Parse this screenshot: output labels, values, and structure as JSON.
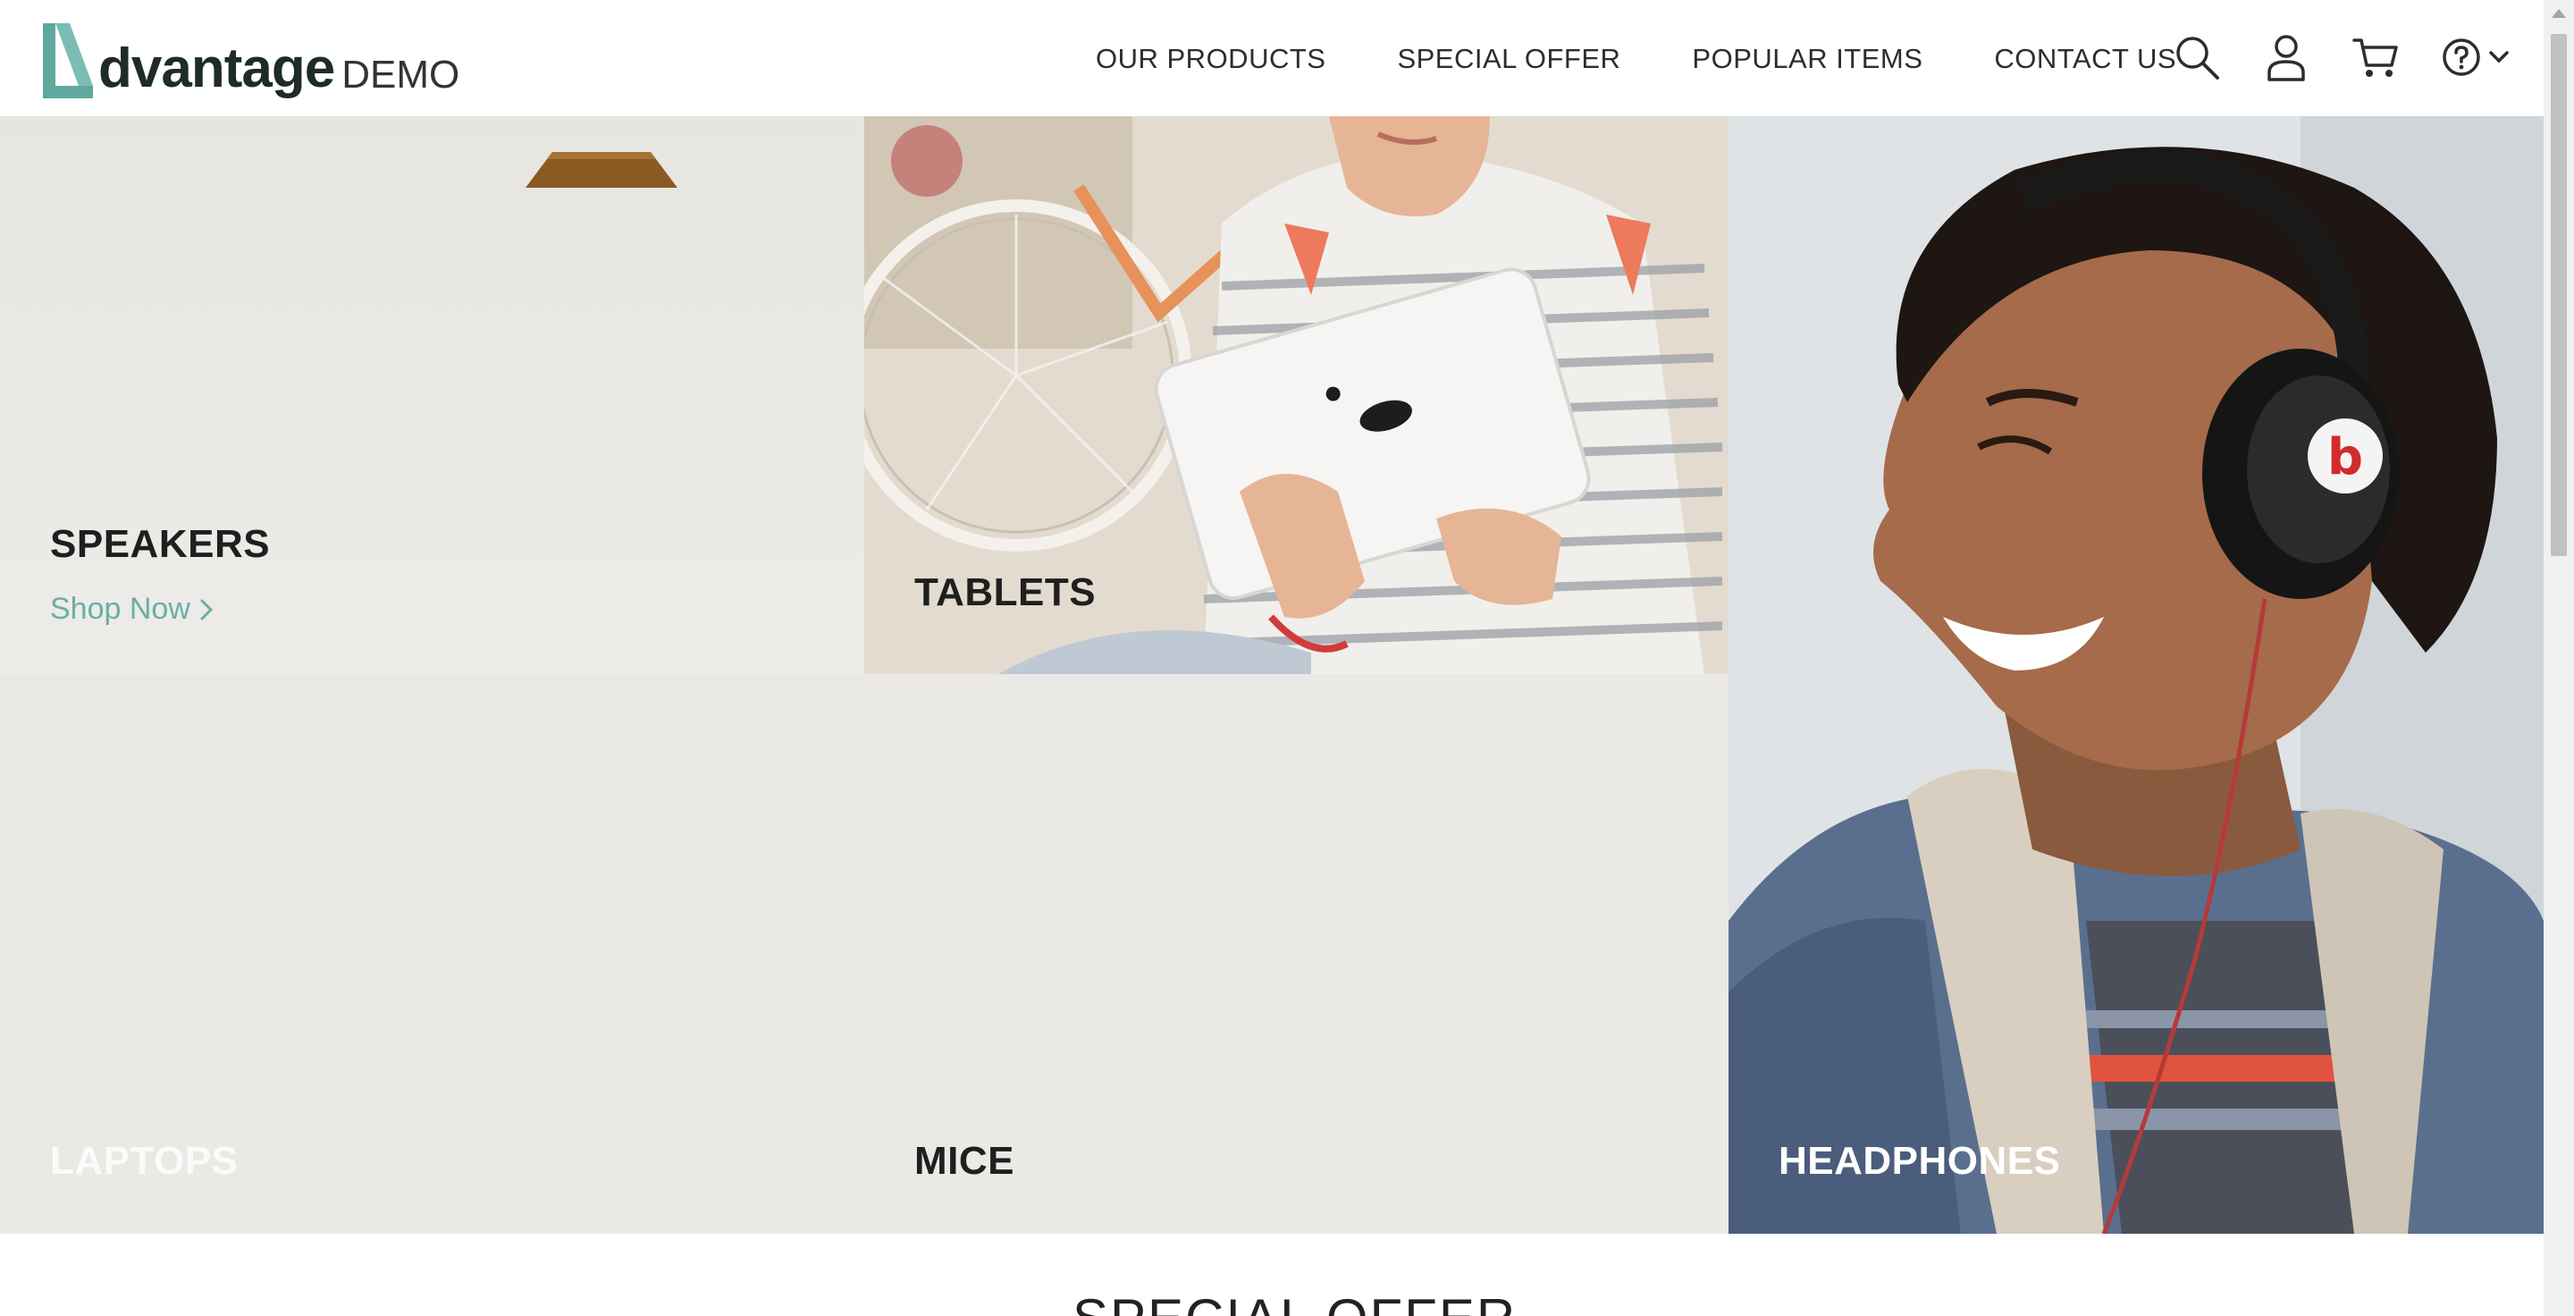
{
  "header": {
    "logo_word": "dvantage",
    "logo_demo": "DEMO",
    "nav": [
      "OUR PRODUCTS",
      "SPECIAL OFFER",
      "POPULAR ITEMS",
      "CONTACT US"
    ],
    "icons": [
      "search-icon",
      "user-icon",
      "cart-icon",
      "help-icon",
      "chevron-down-icon"
    ]
  },
  "categories": {
    "speakers": {
      "label": "SPEAKERS",
      "cta": "Shop Now"
    },
    "tablets": {
      "label": "TABLETS"
    },
    "laptops": {
      "label": "LAPTOPS"
    },
    "mice": {
      "label": "MICE"
    },
    "headphones": {
      "label": "HEADPHONES"
    }
  },
  "section": {
    "title": "SPECIAL OFFER"
  },
  "colors": {
    "accent": "#6aaea7",
    "logo": "#5fa8a0"
  }
}
